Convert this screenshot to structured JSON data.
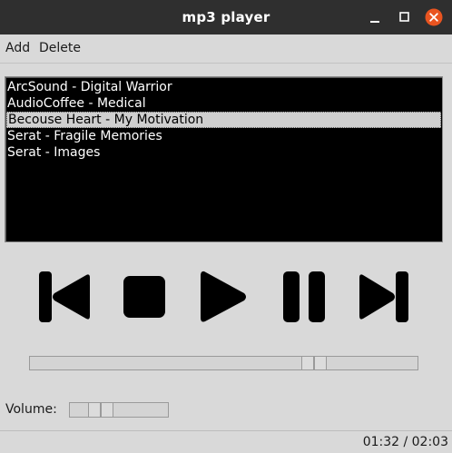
{
  "window": {
    "title": "mp3 player",
    "close_color": "#e95420"
  },
  "menu": {
    "add_label": "Add",
    "delete_label": "Delete"
  },
  "playlist": {
    "songs": [
      "ArcSound - Digital Warrior",
      "AudioCoffee - Medical",
      "Becouse Heart - My Motivation",
      "Serat - Fragile Memories",
      "Serat - Images"
    ],
    "selected_index": 2
  },
  "controls": {
    "icons": [
      "skip-back-icon",
      "stop-icon",
      "play-icon",
      "pause-icon",
      "skip-forward-icon"
    ]
  },
  "seek": {
    "position_fraction": 0.75
  },
  "volume": {
    "label": "Volume:",
    "level_fraction": 0.25
  },
  "status": {
    "time": "01:32 / 02:03"
  }
}
